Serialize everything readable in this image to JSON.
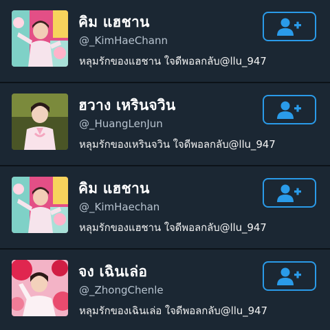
{
  "colors": {
    "background": "#1b2733",
    "divider": "#0c1218",
    "accent": "#2a9be9",
    "name_text": "#ffffff",
    "handle_text": "#b8c4d0",
    "bio_text": "#f2f2f2"
  },
  "rows": [
    {
      "name": "คิม แฮชาน",
      "handle": "@_KimHaeChann",
      "bio": "หลุมรักของแฮชาน ใจดีพอลกลับ@llu_947",
      "follow_icon": "add-user-icon"
    },
    {
      "name": "ฮวาง เหรินจวิน",
      "handle": "@_HuangLenJun",
      "bio": "หลุมรักของเหรินจวิน ใจดีพอลกลับ@llu_947",
      "follow_icon": "add-user-icon"
    },
    {
      "name": "คิม แฮชาน",
      "handle": "@_KimHaechan",
      "bio": "หลุมรักของแฮชาน ใจดีพอลกลับ@llu_947",
      "follow_icon": "add-user-icon"
    },
    {
      "name": "จง เฉินเล่อ",
      "handle": "@_ZhongChenle",
      "bio": "หลุมรักของเฉินเล่อ ใจดีพอลกลับ@llu_947",
      "follow_icon": "add-user-icon"
    }
  ]
}
